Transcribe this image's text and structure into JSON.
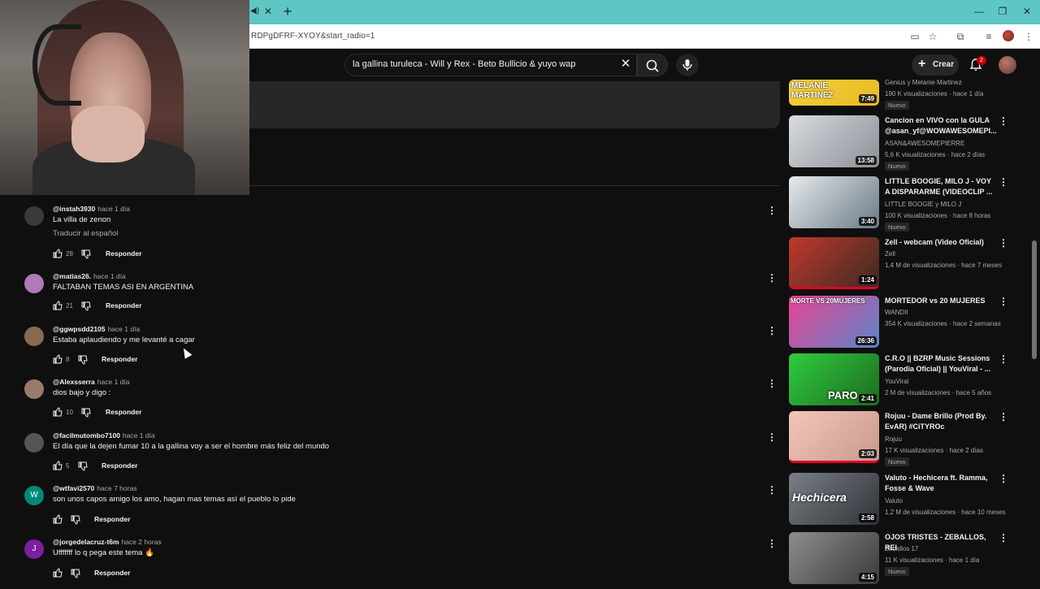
{
  "browser": {
    "url": "RDPgDFRF-XYOY&start_radio=1",
    "tab_new_label": "+",
    "tab_close_label": "✕"
  },
  "header": {
    "search_query": "la gallina turuleca - Will y Rex - Beto Bullicio & yuyo wap",
    "create_label": "Crear",
    "notification_count": "2"
  },
  "comments": [
    {
      "user": "@instah3930",
      "time": "hace 1 día",
      "text": "La villa de zenon",
      "translate": "Traducir al español",
      "likes": "28",
      "reply": "Responder",
      "avatar_color": "#3a3a3a"
    },
    {
      "user": "@matias26.",
      "time": "hace 1 día",
      "text": "FALTABAN TEMAS ASI EN ARGENTINA",
      "likes": "21",
      "reply": "Responder",
      "avatar_color": "#b07ab8"
    },
    {
      "user": "@ggwpsdd2105",
      "time": "hace 1 día",
      "text": "Estaba aplaudiendo y me levanté a cagar",
      "likes": "8",
      "reply": "Responder",
      "avatar_color": "#8a6a50"
    },
    {
      "user": "@Alexsserra",
      "time": "hace 1 día",
      "text": "dios bajo y digo :",
      "likes": "10",
      "reply": "Responder",
      "avatar_color": "#9a7a6a"
    },
    {
      "user": "@facilmutombo7100",
      "time": "hace 1 día",
      "text": "El día que la dejen fumar 10 a la gallina voy a ser el hombre más feliz del mundo",
      "likes": "5",
      "reply": "Responder",
      "avatar_color": "#555555"
    },
    {
      "user": "@wtfavi2570",
      "time": "hace 7 horas",
      "text": "son unos capos amigo los amo, hagan mas temas así el pueblo lo pide",
      "likes": "",
      "reply": "Responder",
      "avatar_color": "#00897b",
      "initial": "W"
    },
    {
      "user": "@jorgedelacruz-t6m",
      "time": "hace 2 horas",
      "text": "Ufffffff lo q pega este tema 🔥",
      "likes": "",
      "reply": "Responder",
      "avatar_color": "#7b1fa2",
      "initial": "J"
    }
  ],
  "videos": [
    {
      "title": "",
      "channel": "Genius",
      "meta": "190 K visualizaciones · hace 1 día",
      "badge": "Nuevo",
      "duration": "7:49",
      "thumb_text": "MELANIE MARTINEZ",
      "colors": [
        "#f4d03f",
        "#e8b923"
      ]
    },
    {
      "title": "Cancion en VIVO con la GULA @asan_yf@WOWAWESOMEPI...",
      "channel": "ASAN&AWESOMEPIERRE",
      "meta": "5,6 K visualizaciones · hace 2 días",
      "badge": "Nuevo",
      "duration": "13:58",
      "colors": [
        "#cfd6dc",
        "#8a8f95"
      ]
    },
    {
      "title": "LITTLE BOOGIE, MILO J - VOY A DISPARARME (VIDEOCLIP ...",
      "channel": "LITTLE BOOGIE y MILO J",
      "meta": "100 K visualizaciones · hace 8 horas",
      "badge": "Nuevo",
      "duration": "3:40",
      "colors": [
        "#d9dde0",
        "#6b7a85"
      ]
    },
    {
      "title": "Zell - webcam (Video Oficial)",
      "channel": "Zell",
      "meta": "1,4 M de visualizaciones · hace 7 meses",
      "badge": "",
      "duration": "1:24",
      "colors": [
        "#c0392b",
        "#3b2a22"
      ]
    },
    {
      "title": "MORTEDOR vs 20 MUJERES",
      "channel": "WANDII",
      "meta": "354 K visualizaciones · hace 2 semanas",
      "badge": "",
      "duration": "26:36",
      "thumb_text": "MORTE VS 20MUJERES",
      "colors": [
        "#e84393",
        "#5b86c9"
      ]
    },
    {
      "title": "C.R.O || BZRP Music Sessions (Parodia Oficial) || YouViral - ...",
      "channel": "YouViral",
      "meta": "2 M de visualizaciones · hace 5 años",
      "badge": "",
      "duration": "2:41",
      "thumb_text": "PARO",
      "colors": [
        "#2ecc40",
        "#1e6b1e"
      ]
    },
    {
      "title": "Rojuu - Dame Brillo (Prod By. EvAR) #CiTYROc",
      "channel": "Rojuu",
      "meta": "17 K visualizaciones · hace 2 días",
      "badge": "Nuevo",
      "duration": "2:03",
      "colors": [
        "#f3c6b8",
        "#c89a8e"
      ]
    },
    {
      "title": "Valuto - Hechicera ft. Ramma, Fosse & Wave",
      "channel": "Valuto",
      "meta": "1,2 M de visualizaciones · hace 10 meses",
      "badge": "",
      "duration": "2:58",
      "thumb_text": "Hechicera",
      "colors": [
        "#7a7f86",
        "#2f3338"
      ]
    },
    {
      "title": "OJOS TRISTES - ZEBALLOS, REI",
      "channel": "Zeballos 17",
      "meta": "11 K visualizaciones · hace 1 día",
      "badge": "Nuevo",
      "duration": "4:15",
      "colors": [
        "#8d8d8d",
        "#3a3a3a"
      ]
    }
  ],
  "top_partial_video": {
    "channel_line": "Genius y Melanie Martinez"
  }
}
